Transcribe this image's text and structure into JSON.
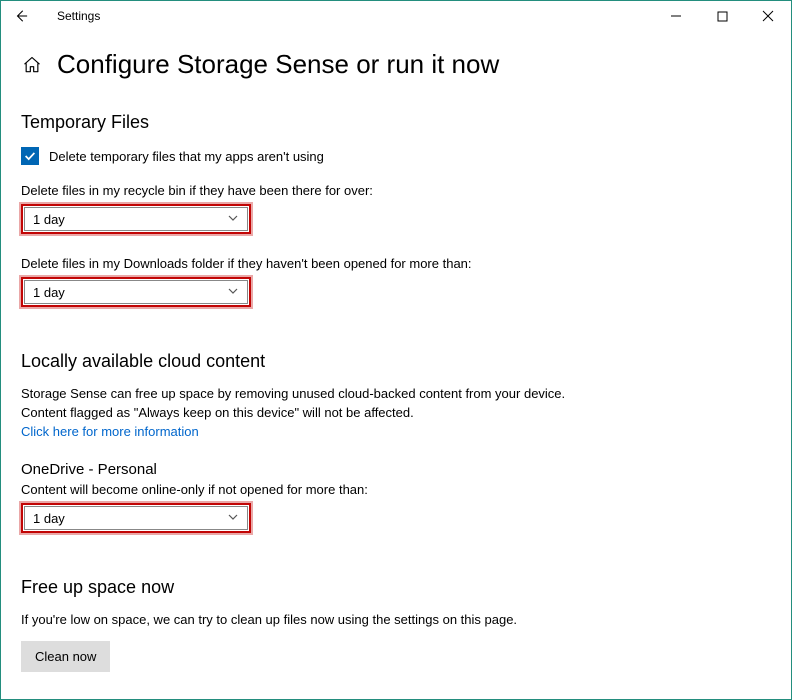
{
  "titlebar": {
    "app_name": "Settings"
  },
  "page": {
    "title": "Configure Storage Sense or run it now"
  },
  "temp": {
    "heading": "Temporary Files",
    "checkbox_label": "Delete temporary files that my apps aren't using",
    "recycle_label": "Delete files in my recycle bin if they have been there for over:",
    "recycle_value": "1 day",
    "downloads_label": "Delete files in my Downloads folder if they haven't been opened for more than:",
    "downloads_value": "1 day"
  },
  "cloud": {
    "heading": "Locally available cloud content",
    "desc1": "Storage Sense can free up space by removing unused cloud-backed content from your device.",
    "desc2": "Content flagged as \"Always keep on this device\" will not be affected.",
    "link": "Click here for more information",
    "onedrive_heading": "OneDrive - Personal",
    "onedrive_desc": "Content will become online-only if not opened for more than:",
    "onedrive_value": "1 day"
  },
  "freeup": {
    "heading": "Free up space now",
    "desc": "If you're low on space, we can try to clean up files now using the settings on this page.",
    "button": "Clean now"
  }
}
